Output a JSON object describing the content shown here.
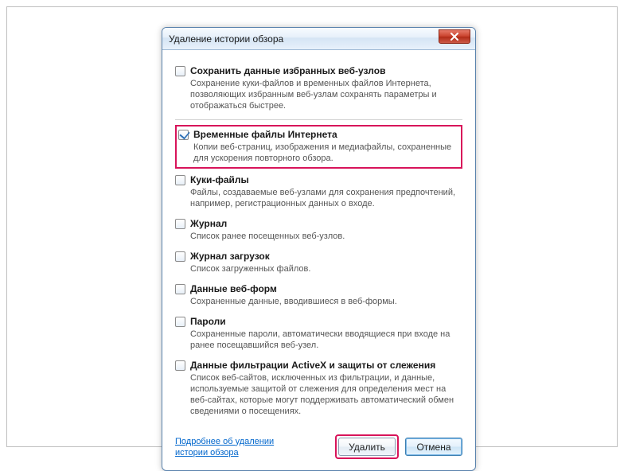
{
  "dialog": {
    "title": "Удаление истории обзора",
    "options": [
      {
        "checked": false,
        "label": "Сохранить данные избранных веб-узлов",
        "desc": "Сохранение куки-файлов и временных файлов Интернета, позволяющих избранным веб-узлам сохранять параметры и отображаться быстрее."
      },
      {
        "checked": true,
        "highlight": true,
        "label": "Временные файлы Интернета",
        "desc": "Копии веб-страниц, изображения и медиафайлы, сохраненные для ускорения повторного обзора."
      },
      {
        "checked": false,
        "label": "Куки-файлы",
        "desc": "Файлы, создаваемые веб-узлами для сохранения предпочтений, например, регистрационных данных о входе."
      },
      {
        "checked": false,
        "label": "Журнал",
        "desc": "Список ранее посещенных веб-узлов."
      },
      {
        "checked": false,
        "label": "Журнал загрузок",
        "desc": "Список загруженных файлов."
      },
      {
        "checked": false,
        "label": "Данные веб-форм",
        "desc": "Сохраненные данные, вводившиеся в веб-формы."
      },
      {
        "checked": false,
        "label": "Пароли",
        "desc": "Сохраненные пароли, автоматически вводящиеся при входе на ранее посещавшийся веб-узел."
      },
      {
        "checked": false,
        "label": "Данные фильтрации ActiveX и защиты от слежения",
        "desc": "Список веб-сайтов, исключенных из фильтрации, и данные, используемые защитой от слежения для определения мест на веб-сайтах, которые могут поддерживать автоматический обмен сведениями о посещениях."
      }
    ],
    "help_link": "Подробнее об удалении истории обзора",
    "delete_btn": "Удалить",
    "cancel_btn": "Отмена"
  }
}
